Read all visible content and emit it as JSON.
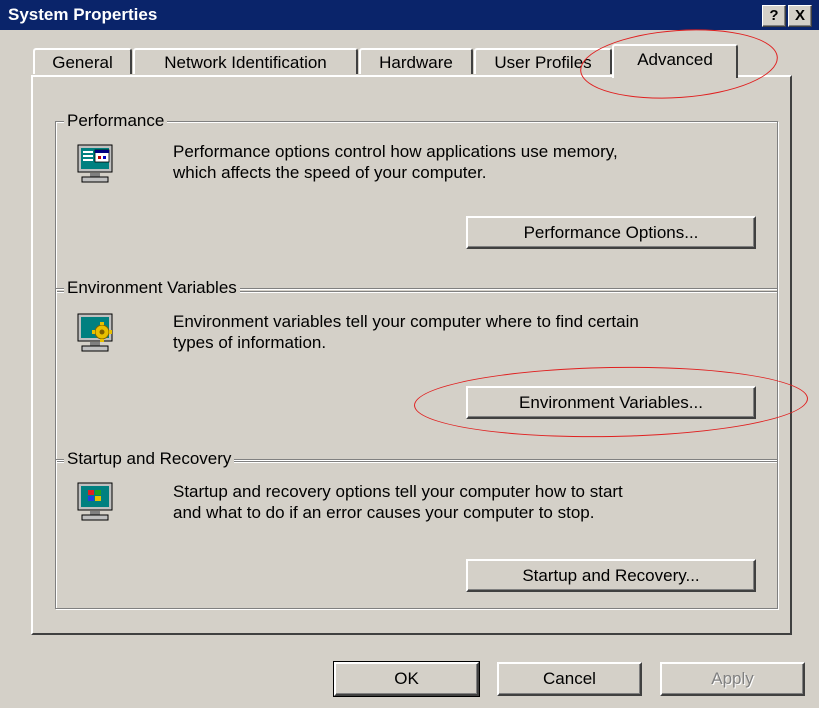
{
  "window": {
    "title": "System Properties",
    "help_label": "?",
    "close_label": "X"
  },
  "tabs": [
    {
      "label": "General"
    },
    {
      "label": "Network Identification"
    },
    {
      "label": "Hardware"
    },
    {
      "label": "User Profiles"
    },
    {
      "label": "Advanced",
      "selected": true
    }
  ],
  "groups": {
    "performance": {
      "title": "Performance",
      "desc_line1": "Performance options control how applications use memory,",
      "desc_line2": "which affects the speed of your computer.",
      "button": "Performance Options...",
      "icon": "performance-monitor-icon"
    },
    "environment": {
      "title": "Environment Variables",
      "desc_line1": "Environment variables tell your computer where to find certain",
      "desc_line2": "types of information.",
      "button": "Environment Variables...",
      "icon": "environment-monitor-icon"
    },
    "startup": {
      "title": "Startup and Recovery",
      "desc_line1": "Startup and recovery options tell your computer how to start",
      "desc_line2": "and what to do if an error causes your computer to stop.",
      "button": "Startup and Recovery...",
      "icon": "windows-monitor-icon"
    }
  },
  "footer": {
    "ok": "OK",
    "cancel": "Cancel",
    "apply": "Apply"
  },
  "annotations": {
    "color": "#e02020"
  },
  "colors": {
    "titlebar": "#0a246a",
    "face": "#d4d0c8"
  }
}
